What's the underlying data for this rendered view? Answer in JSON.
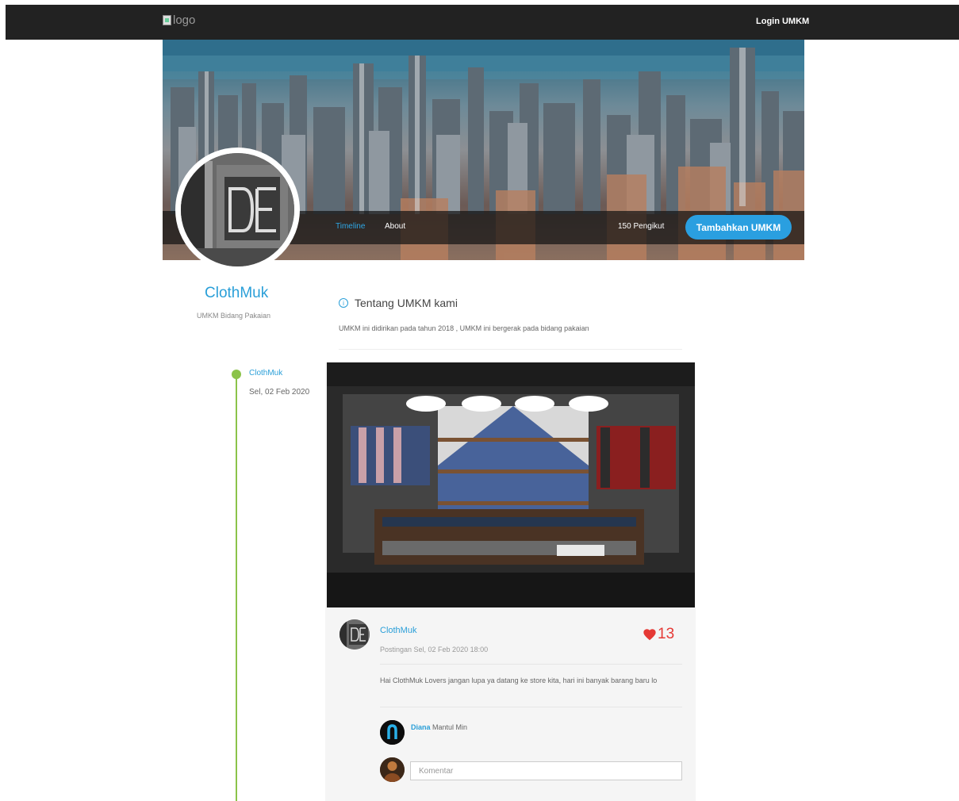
{
  "header": {
    "logo_alt": "logo",
    "login_label": "Login UMKM"
  },
  "profile": {
    "tabs": [
      {
        "label": "Timeline",
        "active": true
      },
      {
        "label": "About",
        "active": false
      }
    ],
    "followers": "150 Pengikut",
    "add_button": "Tambahkan UMKM",
    "name": "ClothMuk",
    "category": "UMKM Bidang Pakaian",
    "about_title": "Tentang UMKM kami",
    "about_text": "UMKM ini didirikan pada tahun 2018 , UMKM ini bergerak pada bidang pakaian"
  },
  "timeline": {
    "author": "ClothMuk",
    "date": "Sel, 02 Feb 2020"
  },
  "post": {
    "author": "ClothMuk",
    "time": "Postingan Sel, 02 Feb 2020 18:00",
    "likes": "13",
    "text": "Hai ClothMuk Lovers jangan lupa ya datang ke store kita, hari ini banyak barang baru lo",
    "comment": {
      "name": "Diana",
      "text": "Mantul Min"
    },
    "comment_placeholder": "Komentar"
  },
  "colors": {
    "accent": "#2a9fe0",
    "timeline": "#8bc34a",
    "like": "#e53935",
    "topbar": "#222222"
  },
  "icons": [
    "info-circle-icon",
    "heart-icon",
    "broken-image-icon"
  ]
}
